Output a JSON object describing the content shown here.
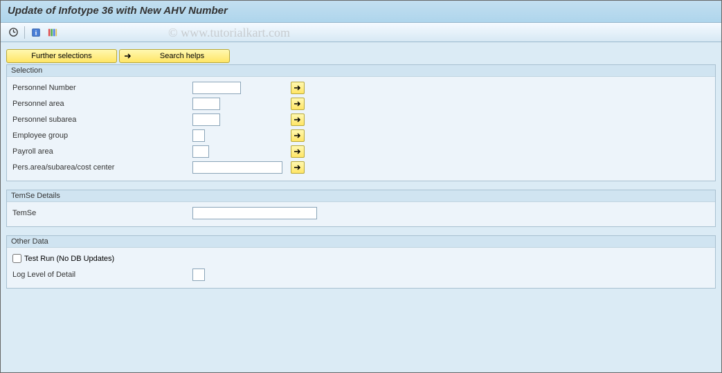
{
  "title": "Update of Infotype 36 with New AHV Number",
  "watermark": "© www.tutorialkart.com",
  "buttons": {
    "further_selections": "Further selections",
    "search_helps": "Search helps"
  },
  "groups": {
    "selection": {
      "title": "Selection",
      "fields": {
        "personnel_number": {
          "label": "Personnel Number",
          "value": ""
        },
        "personnel_area": {
          "label": "Personnel area",
          "value": ""
        },
        "personnel_subarea": {
          "label": "Personnel subarea",
          "value": ""
        },
        "employee_group": {
          "label": "Employee group",
          "value": ""
        },
        "payroll_area": {
          "label": "Payroll area",
          "value": ""
        },
        "pers_area_sub_cc": {
          "label": "Pers.area/subarea/cost center",
          "value": ""
        }
      }
    },
    "temse": {
      "title": "TemSe Details",
      "fields": {
        "temse": {
          "label": "TemSe",
          "value": ""
        }
      }
    },
    "other": {
      "title": "Other Data",
      "fields": {
        "test_run": {
          "label": "Test Run (No DB Updates)",
          "checked": false
        },
        "log_level": {
          "label": "Log Level of Detail",
          "value": ""
        }
      }
    }
  }
}
